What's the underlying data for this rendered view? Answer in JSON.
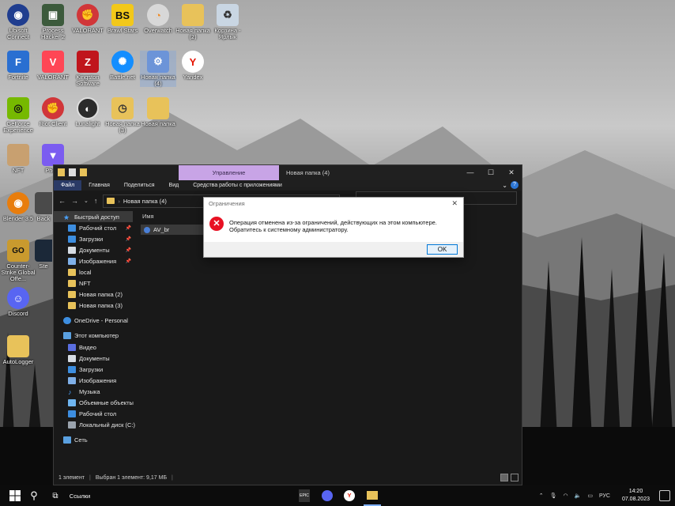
{
  "desktop": {
    "icons": [
      {
        "label": "Ubisoft Connect",
        "icon": "ubisoft-icon",
        "color": "#1f3d8f"
      },
      {
        "label": "Process Hacker 2",
        "icon": "process-hacker-icon",
        "color": "#3c5a3c"
      },
      {
        "label": "VALORANT",
        "icon": "riot-icon",
        "color": "#d13639"
      },
      {
        "label": "Brawl Stars",
        "icon": "brawl-stars-icon",
        "color": "#f2c81a"
      },
      {
        "label": "Overwatch",
        "icon": "overwatch-icon",
        "color": "#d8d8d8"
      },
      {
        "label": "Новая папка (2)",
        "icon": "folder-icon",
        "color": "#e8c25a"
      },
      {
        "label": "Корзина - Ярлык",
        "icon": "recycle-bin-icon",
        "color": "#c9d6e3"
      },
      {
        "label": "Fortnite",
        "icon": "fortnite-icon",
        "color": "#2a6fd1"
      },
      {
        "label": "VALORANT",
        "icon": "valorant-icon",
        "color": "#ff4655"
      },
      {
        "label": "Kingston Software",
        "icon": "kingston-icon",
        "color": "#c0151c"
      },
      {
        "label": "Battle.net",
        "icon": "battlenet-icon",
        "color": "#148eff"
      },
      {
        "label": "Новая папка (4)",
        "icon": "folder-icon",
        "color": "#6c94d8"
      },
      {
        "label": "Yandex",
        "icon": "yandex-icon",
        "color": "#ffffff"
      },
      {
        "label": "GeForce Experience",
        "icon": "geforce-icon",
        "color": "#76b900"
      },
      {
        "label": "Riot Client",
        "icon": "riot-client-icon",
        "color": "#d13639"
      },
      {
        "label": "Lunalight",
        "icon": "lunalight-icon",
        "color": "#2b2b2b"
      },
      {
        "label": "Новая папка (3)",
        "icon": "folder-icon",
        "color": "#e8c25a"
      },
      {
        "label": "Новая папка",
        "icon": "folder-icon",
        "color": "#e8c25a"
      },
      {
        "label": "NFT",
        "icon": "nft-icon",
        "color": "#c8a070"
      },
      {
        "label": "Photo",
        "icon": "photo-icon",
        "color": "#7b5cf0"
      },
      {
        "label": "Blender 3.5",
        "icon": "blender-icon",
        "color": "#e87d0d"
      },
      {
        "label": "Back",
        "icon": "back-icon",
        "color": "#4a4a4a"
      },
      {
        "label": "Counter-Strike Global Offe...",
        "icon": "csgo-icon",
        "color": "#c99a2e"
      },
      {
        "label": "Ste",
        "icon": "steam-icon",
        "color": "#1b2838"
      },
      {
        "label": "Discord",
        "icon": "discord-icon",
        "color": "#5865f2"
      },
      {
        "label": "AutoLogger",
        "icon": "folder-icon",
        "color": "#e8c25a"
      }
    ]
  },
  "explorer": {
    "manage_tab": "Управление",
    "window_title": "Новая папка (4)",
    "ribbon_tabs": [
      "Файл",
      "Главная",
      "Поделиться",
      "Вид",
      "Средства работы с приложениями"
    ],
    "address": "Новая папка (4)",
    "nav": {
      "quick_access": "Быстрый доступ",
      "quick_items": [
        "Рабочий стол",
        "Загрузки",
        "Документы",
        "Изображения",
        "local",
        "NFT",
        "Новая папка (2)",
        "Новая папка (3)"
      ],
      "onedrive": "OneDrive - Personal",
      "this_pc": "Этот компьютер",
      "pc_items": [
        "Видео",
        "Документы",
        "Загрузки",
        "Изображения",
        "Музыка",
        "Объемные объекты",
        "Рабочий стол",
        "Локальный диск (C:)"
      ],
      "network": "Сеть"
    },
    "column_name": "Имя",
    "file_name": "AV_br",
    "status": {
      "count": "1 элемент",
      "selected": "Выбран 1 элемент: 9,17 МБ"
    }
  },
  "dialog": {
    "title": "Ограничения",
    "message": "Операция отменена из-за ограничений, действующих на этом компьютере. Обратитесь к системному администратору.",
    "ok_label": "OK"
  },
  "taskbar": {
    "search_label": "Ссылки",
    "language": "РУС",
    "time": "14:20",
    "date": "07.08.2023"
  }
}
